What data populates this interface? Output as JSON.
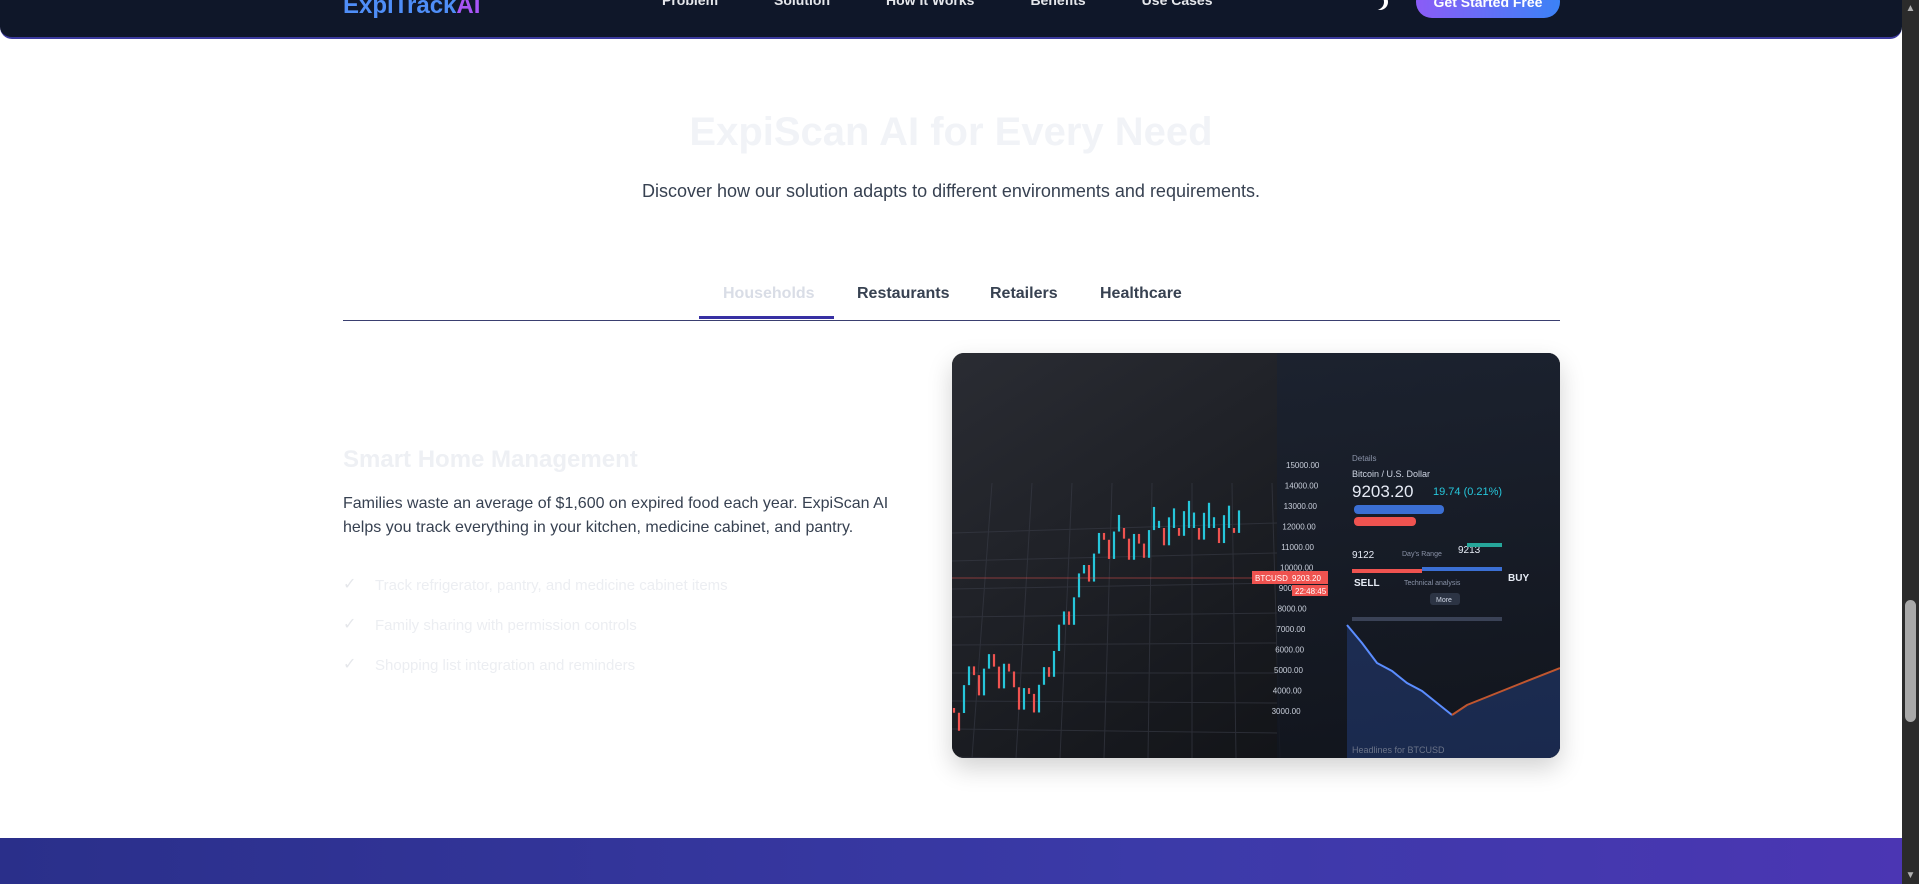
{
  "nav": {
    "logo_main": "ExpiTrack",
    "logo_accent": "AI",
    "links": [
      "Problem",
      "Solution",
      "How It Works",
      "Benefits",
      "Use Cases"
    ],
    "cta_label": "Get Started Free",
    "theme_icon": "moon-icon"
  },
  "section": {
    "title": "ExpiScan AI for Every Need",
    "subtitle": "Discover how our solution adapts to different environments and requirements."
  },
  "tabs": [
    {
      "label": "Households",
      "active": true
    },
    {
      "label": "Restaurants",
      "active": false
    },
    {
      "label": "Retailers",
      "active": false
    },
    {
      "label": "Healthcare",
      "active": false
    }
  ],
  "content": {
    "title": "Smart Home Management",
    "description": "Families waste an average of $1,600 on expired food each year. ExpiScan AI helps you track everything in your kitchen, medicine cabinet, and pantry.",
    "features": [
      "Track refrigerator, pantry, and medicine cabinet items",
      "Family sharing with permission controls",
      "Shopping list integration and reminders"
    ],
    "check_icon": "check-icon"
  },
  "image": {
    "asset_label": "Bitcoin / U.S. Dollar",
    "price": "9203.20",
    "change": "19.74 (0.21%)",
    "ticker_tag": "BTCUSD",
    "ticker_price": "9203.20",
    "ticker_time": "22:48:45",
    "sell_label": "SELL",
    "buy_label": "BUY",
    "sell_price": "9122",
    "buy_price": "9213",
    "range_label": "Day's Range",
    "tech_label": "Technical analysis",
    "more_label": "More",
    "details_label": "Details",
    "axis_ticks": [
      "15000.00",
      "14000.00",
      "13000.00",
      "12000.00",
      "11000.00",
      "10000.00",
      "9000.00",
      "8000.00",
      "7000.00",
      "6000.00",
      "5000.00",
      "4000.00",
      "3000.00"
    ],
    "headline_label": "Headlines for BTCUSD"
  },
  "colors": {
    "accent": "#3730a3",
    "nav_bg": "#0f1729",
    "cta_from": "#8b5cf6",
    "cta_to": "#3b82f6",
    "candle_up": "#26c6da",
    "candle_down": "#ef5350"
  }
}
